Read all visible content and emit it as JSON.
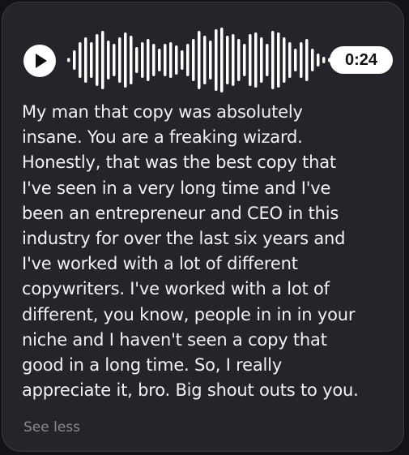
{
  "voice_message": {
    "duration": "0:24",
    "play_icon": "play-icon",
    "waveform_levels": [
      0.05,
      0.3,
      0.55,
      0.7,
      0.55,
      0.8,
      0.9,
      0.6,
      0.5,
      0.7,
      0.85,
      0.75,
      0.4,
      0.55,
      0.65,
      0.5,
      0.35,
      0.5,
      0.55,
      0.45,
      0.3,
      0.5,
      0.65,
      0.9,
      0.75,
      0.6,
      0.95,
      1.0,
      0.75,
      0.8,
      0.65,
      0.5,
      0.8,
      0.85,
      0.7,
      0.5,
      0.9,
      0.85,
      0.7,
      0.55,
      0.35,
      0.55,
      0.65,
      0.35,
      0.2,
      0.1,
      0.05
    ]
  },
  "transcript": {
    "lines": [
      "My man that copy was absolutely",
      "insane. You are a freaking wizard.",
      "Honestly, that was the best copy that",
      "I've seen in a very long time and I've",
      "been an entrepreneur and CEO in this",
      "industry for over the last six years and",
      "I've worked with a lot of different",
      "copywriters. I've worked with a lot of",
      "different, you know, people in in in your",
      "niche and I haven't seen a copy that",
      "good in a long time. So, I really",
      "appreciate it, bro. Big shout outs to you."
    ]
  },
  "see_less_label": "See less",
  "colors": {
    "bubble_background": "#23252a",
    "text": "#f2f2f2",
    "muted": "#8a8b8f",
    "accent": "#ffffff"
  }
}
